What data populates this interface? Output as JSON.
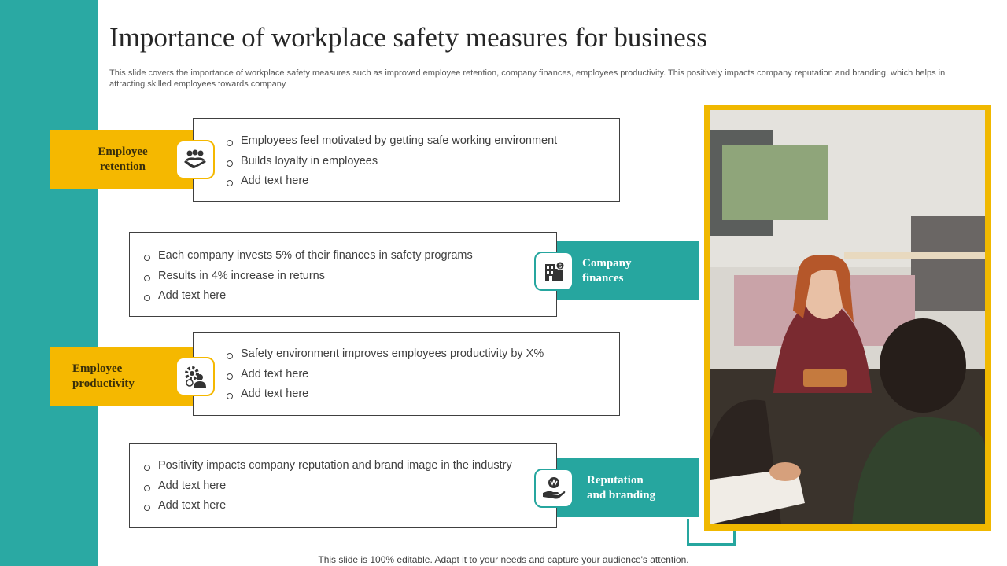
{
  "title": "Importance of workplace safety measures for business",
  "subtitle": "This slide covers the importance of workplace safety measures such as improved employee retention, company finances, employees productivity. This positively impacts company reputation and branding, which helps in attracting skilled employees towards company",
  "sections": [
    {
      "label_line1": "Employee",
      "label_line2": "retention",
      "icon": "handshake-group-icon",
      "bullets": [
        "Employees feel motivated by getting safe working environment",
        "Builds loyalty  in employees",
        "Add text here"
      ]
    },
    {
      "label_line1": "Company",
      "label_line2": "finances",
      "icon": "building-finance-icon",
      "bullets": [
        "Each company invests 5% of their finances in safety programs",
        "Results in 4% increase in returns",
        "Add text here"
      ]
    },
    {
      "label_line1": "Employee",
      "label_line2": "productivity",
      "icon": "gear-person-icon",
      "bullets": [
        "Safety environment improves employees productivity by X%",
        "Add text here",
        "Add text here"
      ]
    },
    {
      "label_line1": "Reputation",
      "label_line2": "and branding",
      "icon": "hand-badge-icon",
      "bullets": [
        "Positivity impacts company reputation and brand image in the industry",
        "Add text here",
        "Add text here"
      ]
    }
  ],
  "footer": "This slide is 100% editable. Adapt it to your needs and capture your audience's attention.",
  "colors": {
    "teal": "#26a69f",
    "yellow": "#f5b800",
    "frame": "#f0b800"
  }
}
